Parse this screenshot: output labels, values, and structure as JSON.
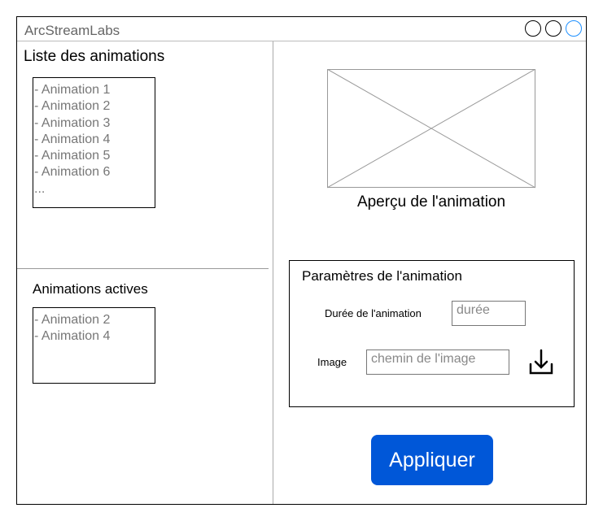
{
  "window": {
    "title": "ArcStreamLabs",
    "controls": [
      "minimize",
      "maximize",
      "close"
    ],
    "close_color": "#1e90ff"
  },
  "animation_list": {
    "heading": "Liste des animations",
    "items": [
      "- Animation 1",
      "- Animation 2",
      "- Animation 3",
      "- Animation 4",
      "- Animation 5",
      "- Animation 6",
      "..."
    ]
  },
  "active_animations": {
    "heading": "Animations actives",
    "items": [
      "- Animation 2",
      "- Animation 4"
    ]
  },
  "preview": {
    "caption": "Aperçu de l'animation"
  },
  "parameters": {
    "heading": "Paramètres de l'animation",
    "duration_label": "Durée de l'animation",
    "duration_placeholder": "durée",
    "image_label": "Image",
    "image_placeholder": "chemin de l'image",
    "browse_icon": "download-icon"
  },
  "apply": {
    "label": "Appliquer",
    "color": "#0057D8"
  }
}
